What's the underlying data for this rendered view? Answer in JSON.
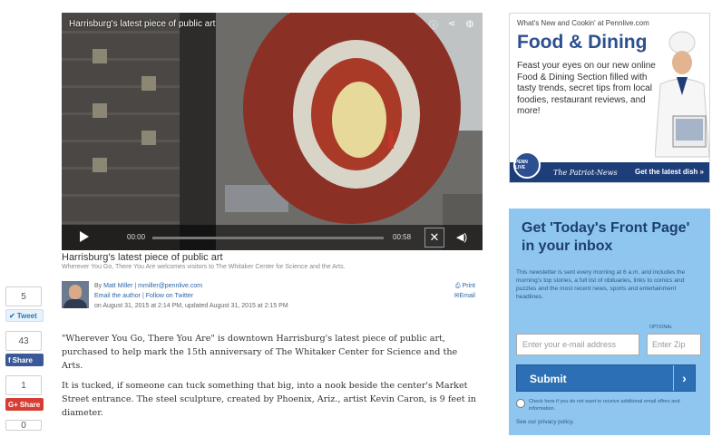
{
  "video": {
    "title": "Harrisburg's latest piece of public art",
    "time_current": "00:00",
    "time_duration": "00:58",
    "top_icons": [
      "info-icon",
      "share-icon",
      "globe-icon"
    ]
  },
  "caption": {
    "title": "Harrisburg's latest piece of public art",
    "subtitle": "Wherever You Go, There You Are welcomes visitors to The Whitaker Center for Science and the Arts."
  },
  "share": {
    "tweet_count": "5",
    "tweet_label": "Tweet",
    "fb_count": "43",
    "fb_label": "Share",
    "gplus_count": "1",
    "gplus_label": "Share",
    "extra_count": "0"
  },
  "byline": {
    "by_prefix": "By",
    "author": "Matt Miller",
    "email": "mmiller@pennlive.com",
    "email_author": "Email the author",
    "follow": "Follow on Twitter",
    "sep": "|",
    "dateline": "on August 31, 2015 at 2:14 PM, updated August 31, 2015 at 2:15 PM",
    "print": "Print",
    "email_action": "Email"
  },
  "article": {
    "p1": "\"Wherever You Go, There You Are\" is downtown Harrisburg's latest piece of public art, purchased to help mark the 15th anniversary of The Whitaker Center for Science and the Arts.",
    "p2": "It is tucked, if someone can tuck something that big, into a nook beside the center's Market Street entrance. The steel sculpture, created by Phoenix, Ariz., artist Kevin Caron, is 9 feet in diameter."
  },
  "ad_food": {
    "top": "What's New and Cookin' at Pennlive.com",
    "heading": "Food & Dining",
    "body": "Feast your eyes on our new online Food & Dining Section filled with tasty trends, secret tips from local foodies, restaurant reviews, and more!",
    "logo": "PENN LIVE",
    "patriot": "The Patriot-News",
    "cta": "Get the latest dish »"
  },
  "ad_newsletter": {
    "heading": "Get 'Today's Front Page' in your inbox",
    "body": "This newsletter is sent every morning at 6 a.m. and includes the morning's top stories, a full list of obituaries, links to comics and puzzles and the most recent news, sports and entertainment headlines.",
    "optional": "OPTIONAL",
    "email_placeholder": "Enter your e-mail address",
    "zip_placeholder": "Enter Zip",
    "submit": "Submit",
    "arrow": "›",
    "checkbox_text": "Check here if you do not want to receive additional email offers and information.",
    "privacy": "See our privacy policy."
  },
  "colors": {
    "brand_blue": "#2c4f8f",
    "newsletter_bg": "#8ec6ef",
    "submit_blue": "#2c6fb4",
    "facebook": "#3b5998",
    "gplus": "#d73d32"
  }
}
